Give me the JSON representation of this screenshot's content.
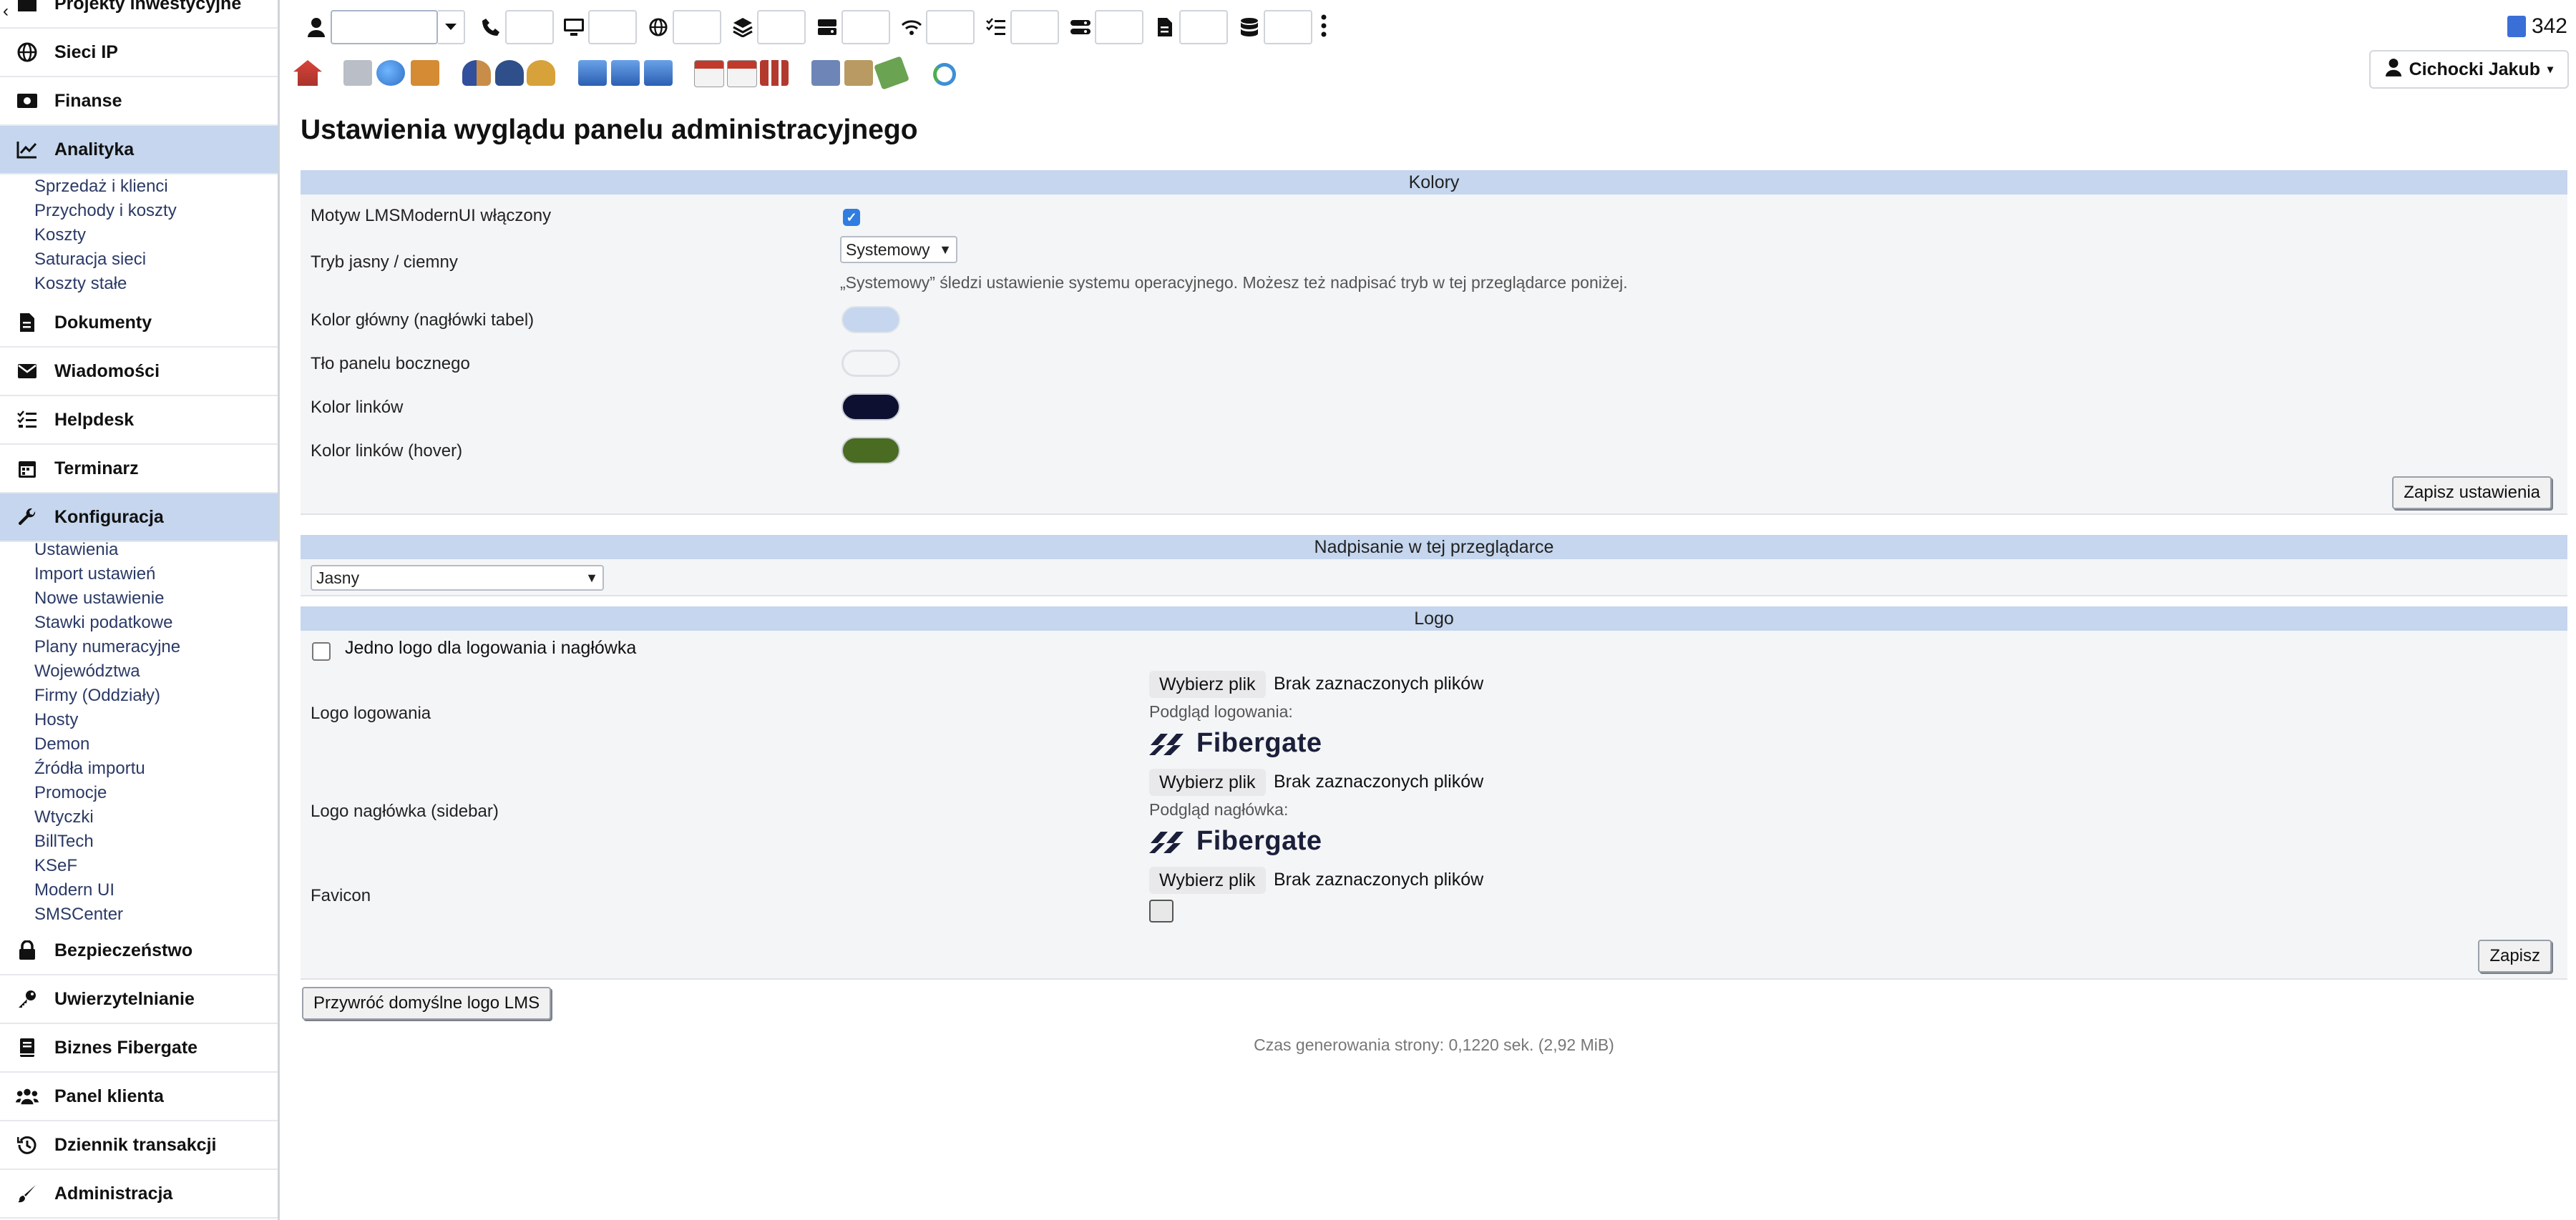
{
  "sidebar": {
    "items": [
      {
        "label": "Projekty inwestycyjne",
        "icon": "folder-icon"
      },
      {
        "label": "Sieci IP",
        "icon": "globe-icon"
      },
      {
        "label": "Finanse",
        "icon": "money-icon"
      },
      {
        "label": "Analityka",
        "icon": "chart-line-icon",
        "active": true
      },
      {
        "label": "Dokumenty",
        "icon": "document-icon"
      },
      {
        "label": "Wiadomości",
        "icon": "envelope-icon"
      },
      {
        "label": "Helpdesk",
        "icon": "tasks-icon"
      },
      {
        "label": "Terminarz",
        "icon": "calendar-icon"
      },
      {
        "label": "Konfiguracja",
        "icon": "wrench-icon",
        "active": true
      },
      {
        "label": "Bezpieczeństwo",
        "icon": "lock-icon"
      },
      {
        "label": "Uwierzytelnianie",
        "icon": "key-icon"
      },
      {
        "label": "Biznes Fibergate",
        "icon": "book-icon"
      },
      {
        "label": "Panel klienta",
        "icon": "users-icon"
      },
      {
        "label": "Dziennik transakcji",
        "icon": "history-icon"
      },
      {
        "label": "Administracja",
        "icon": "brush-icon"
      }
    ],
    "analityka_sub": [
      "Sprzedaż i klienci",
      "Przychody i koszty",
      "Koszty",
      "Saturacja sieci",
      "Koszty stałe"
    ],
    "konfiguracja_sub": [
      "Ustawienia",
      "Import ustawień",
      "Nowe ustawienie",
      "Stawki podatkowe",
      "Plany numeracyjne",
      "Województwa",
      "Firmy (Oddziały)",
      "Hosty",
      "Demon",
      "Źródła importu",
      "Promocje",
      "Wtyczki",
      "BillTech",
      "KSeF",
      "Modern UI",
      "SMSCenter"
    ]
  },
  "topbar": {
    "counter": "342",
    "user": "Cichocki Jakub",
    "search_icons": [
      "user-icon",
      "phone-icon",
      "desktop-icon",
      "globe-icon",
      "layers-icon",
      "server-icon",
      "wifi-icon",
      "checklist-icon",
      "network-icon",
      "file-icon",
      "database-icon",
      "more-icon"
    ]
  },
  "page": {
    "title": "Ustawienia wyglądu panelu administracyjnego",
    "kolory": {
      "header": "Kolory",
      "theme_label": "Motyw LMSModernUI włączony",
      "mode_label": "Tryb jasny / ciemny",
      "mode_value": "Systemowy",
      "mode_hint": "„Systemowy” śledzi ustawienie systemu operacyjnego. Możesz też nadpisać tryb w tej przeglądarce poniżej.",
      "primary_label": "Kolor główny (nagłówki tabel)",
      "sidebar_bg_label": "Tło panelu bocznego",
      "link_label": "Kolor linków",
      "link_hover_label": "Kolor linków (hover)",
      "colors": {
        "primary": "#c5d6ee",
        "sidebar_bg": "#f4f5f7",
        "link": "#0d1030",
        "link_hover": "#4a6b22"
      },
      "save_button": "Zapisz ustawienia"
    },
    "override": {
      "header": "Nadpisanie w tej przeglądarce",
      "value": "Jasny"
    },
    "logo": {
      "header": "Logo",
      "single_logo_label": "Jedno logo dla logowania i nagłówka",
      "login_logo_label": "Logo logowania",
      "header_logo_label": "Logo nagłówka (sidebar)",
      "favicon_label": "Favicon",
      "choose_file": "Wybierz plik",
      "no_file": "Brak zaznaczonych plików",
      "login_preview_label": "Podgląd logowania:",
      "header_preview_label": "Podgląd nagłówka:",
      "brand": "Fibergate",
      "save_button": "Zapisz"
    },
    "restore_button": "Przywróć domyślne logo LMS",
    "footer": "Czas generowania strony: 0,1220 sek. (2,92 MiB)"
  }
}
